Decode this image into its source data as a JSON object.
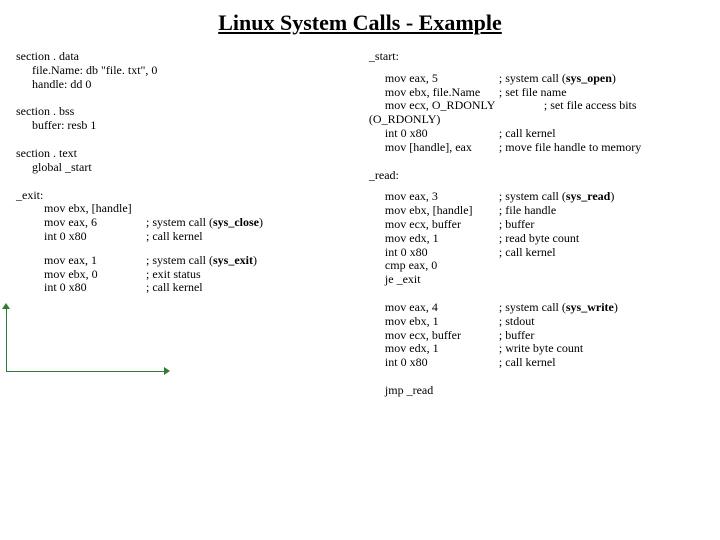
{
  "title": "Linux System Calls - Example",
  "left": {
    "data_sec": {
      "l1": "section        . data",
      "l2": "file.Name:  db  \"file. txt\", 0",
      "l3": "handle:  dd 0"
    },
    "bss_sec": {
      "l1": "section . bss",
      "l2": "buffer:   resb    1"
    },
    "text_sec": {
      "l1": "section          . text",
      "l2": "global _start"
    },
    "exit": {
      "label": "_exit:",
      "l1": "mov ebx, [handle]",
      "l2": "mov eax, 6",
      "l2c": "; system call (",
      "l2c_b": "sys_close",
      "l2c_e": ")",
      "l3": "int 0 x80",
      "l3c": "; call kernel"
    },
    "exit2": {
      "l1": "mov eax,    1",
      "l1c": "; system call (",
      "l1c_b": "sys_exit",
      "l1c_e": ")",
      "l2": "mov ebx,    0",
      "l2c": "; exit status",
      "l3": "int 0 x80",
      "l3c": "; call kernel"
    }
  },
  "right": {
    "start": {
      "label": "_start:",
      "l1": "mov eax, 5",
      "l1c": "; system call (",
      "l1c_b": "sys_open",
      "l1c_e": ")",
      "l2": "mov ebx, file.Name",
      "l2c": "; set file name",
      "l3": "mov ecx, O_RDONLY",
      "l3c": "; set file access bits",
      "l4": "(O_RDONLY)",
      "l5": "int 0 x80",
      "l5c": "; call kernel",
      "l6": "mov [handle], eax",
      "l6c": "; move file handle to memory"
    },
    "read": {
      "label": "_read:",
      "l1": "mov eax, 3",
      "l1c": "; system call (",
      "l1c_b": "sys_read",
      "l1c_e": ")",
      "l2": "mov ebx, [handle]",
      "l2c": "; file handle",
      "l3": "mov ecx, buffer",
      "l3c": "; buffer",
      "l4": "mov edx, 1",
      "l4c": "; read byte count",
      "l5": "int 0 x80",
      "l5c": "; call kernel",
      "l6": "cmp eax, 0",
      "l7": "je _exit"
    },
    "write": {
      "l1": "mov eax, 4",
      "l1c": "; system call (",
      "l1c_b": "sys_write",
      "l1c_e": ")",
      "l2": "mov ebx, 1",
      "l2c": "; stdout",
      "l3": "mov ecx, buffer",
      "l3c": "; buffer",
      "l4": "mov edx, 1",
      "l4c": "; write byte count",
      "l5": "int 0 x80",
      "l5c": "; call kernel"
    },
    "jmp": "jmp _read"
  }
}
